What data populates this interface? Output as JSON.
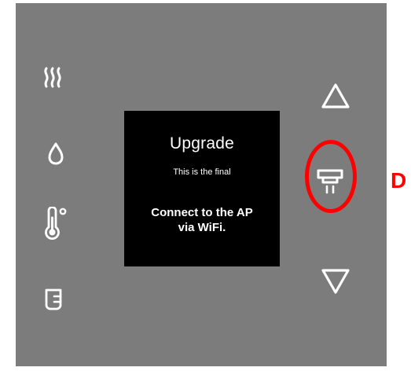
{
  "screen": {
    "title": "Upgrade",
    "subtitle": "This is the final",
    "message_line1": "Connect to the AP",
    "message_line2": "via WiFi."
  },
  "left_buttons": [
    {
      "icon": "heat-waves-icon"
    },
    {
      "icon": "water-drop-icon"
    },
    {
      "icon": "thermometer-celsius-icon"
    },
    {
      "icon": "cup-level-icon"
    }
  ],
  "right_buttons": [
    {
      "icon": "arrow-up-triangle-icon"
    },
    {
      "icon": "dispense-tap-icon",
      "highlighted": true
    },
    {
      "icon": "arrow-down-triangle-icon"
    }
  ],
  "callout": {
    "text": "D"
  },
  "colors": {
    "panel": "#7c7c7c",
    "screen": "#000000",
    "icon": "#ffffff",
    "highlight": "#ff0000"
  }
}
